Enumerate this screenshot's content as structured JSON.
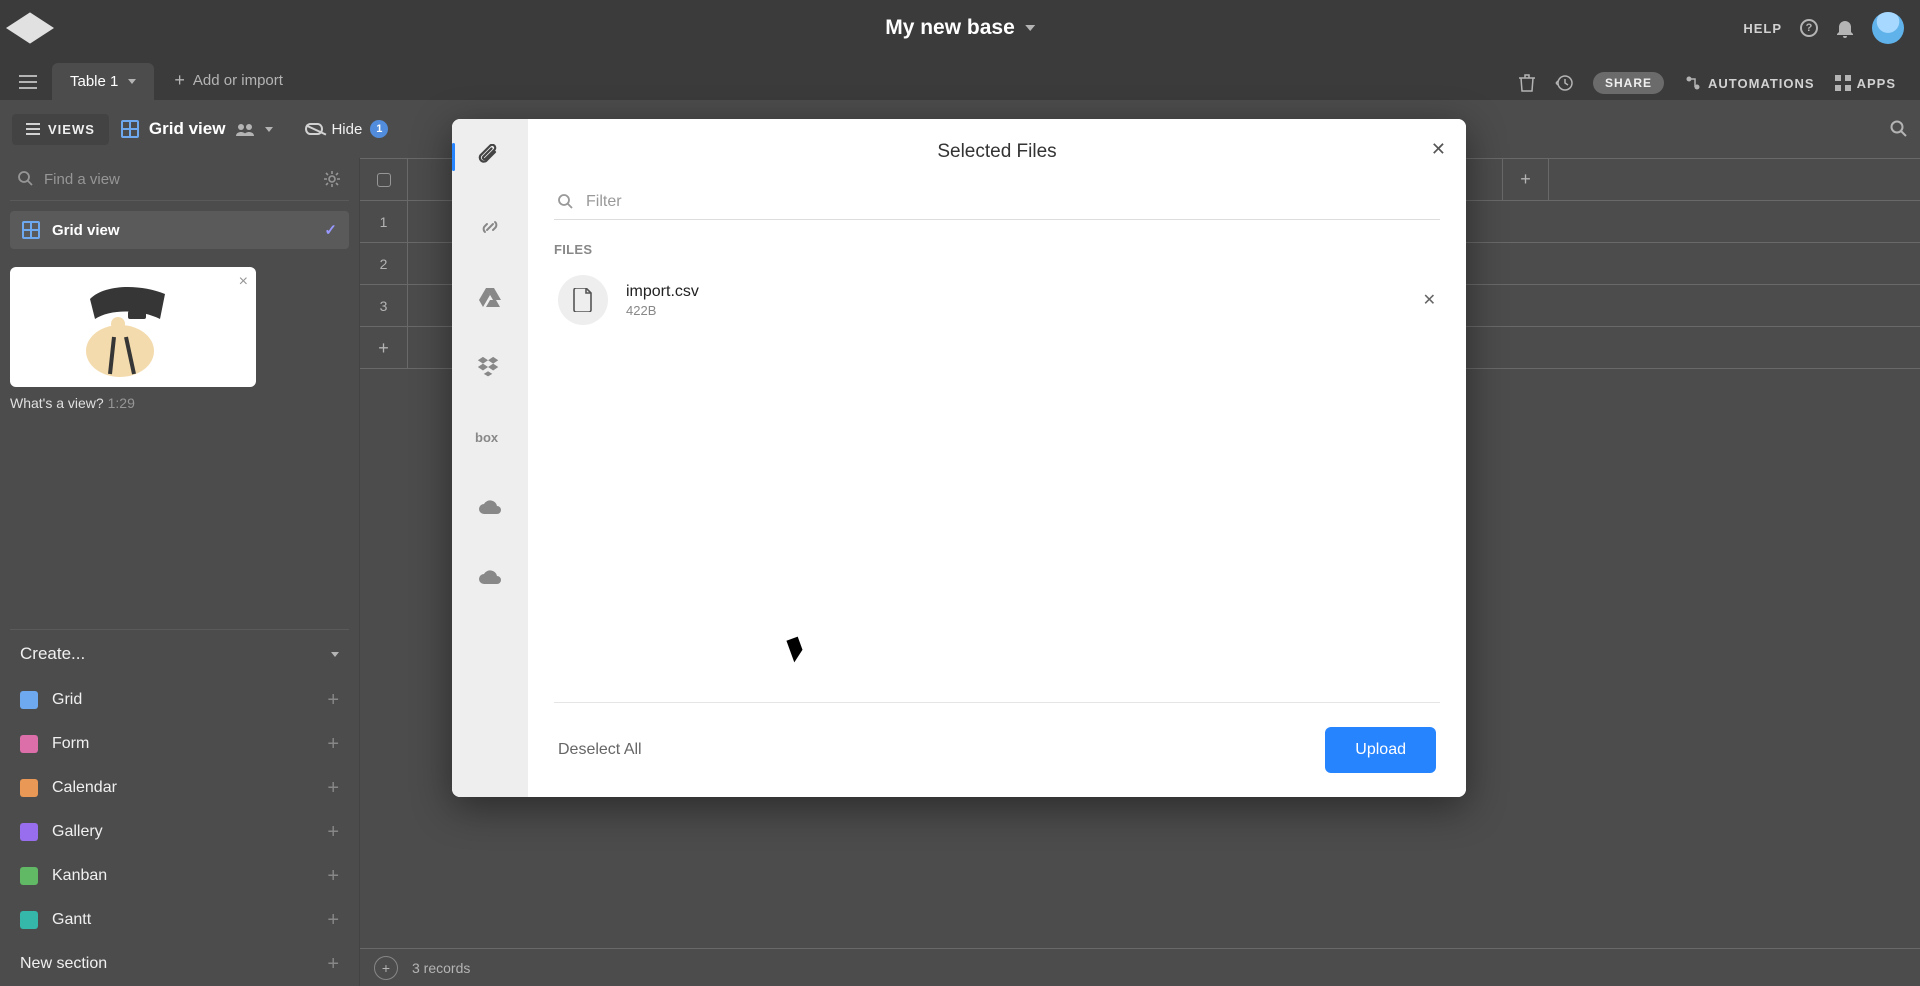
{
  "header": {
    "base_title": "My new base",
    "help_label": "HELP"
  },
  "tabs": {
    "active": "Table 1",
    "add_import": "Add or import",
    "share": "SHARE",
    "automations": "AUTOMATIONS",
    "apps": "APPS"
  },
  "view_toolbar": {
    "views_btn": "VIEWS",
    "view_name": "Grid view",
    "hide_label": "Hide",
    "hide_count": "1"
  },
  "sidebar": {
    "find_placeholder": "Find a view",
    "active_view": "Grid view",
    "promo_caption": "What's a view?",
    "promo_duration": "1:29",
    "create_label": "Create...",
    "view_types": [
      {
        "label": "Grid",
        "icon": "ico-grid"
      },
      {
        "label": "Form",
        "icon": "ico-form"
      },
      {
        "label": "Calendar",
        "icon": "ico-cal"
      },
      {
        "label": "Gallery",
        "icon": "ico-gal"
      },
      {
        "label": "Kanban",
        "icon": "ico-kan"
      },
      {
        "label": "Gantt",
        "icon": "ico-gantt"
      }
    ],
    "new_section": "New section"
  },
  "grid": {
    "rows": [
      "1",
      "2",
      "3"
    ],
    "footer": "3 records"
  },
  "modal": {
    "title": "Selected Files",
    "filter_placeholder": "Filter",
    "files_heading": "FILES",
    "file": {
      "name": "import.csv",
      "size": "422B"
    },
    "deselect": "Deselect All",
    "upload": "Upload"
  }
}
